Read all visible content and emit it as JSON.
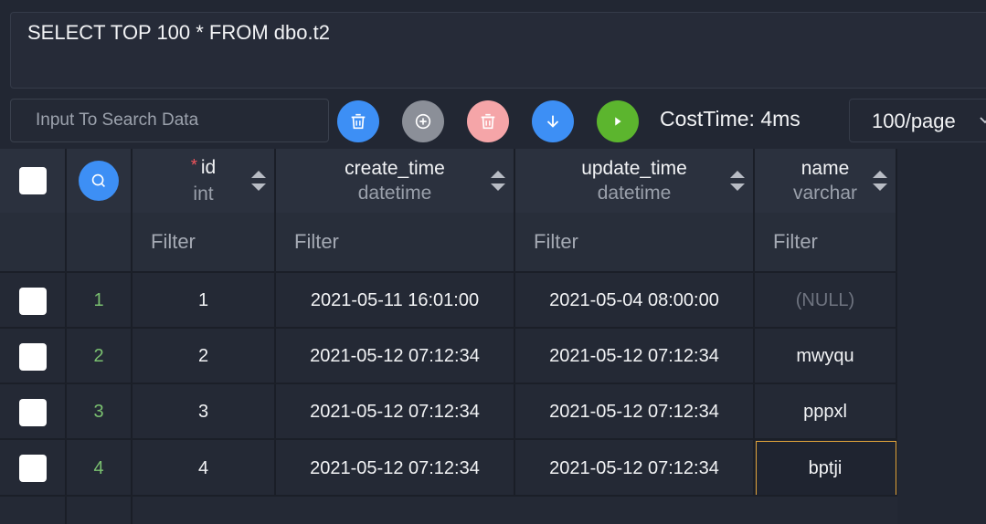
{
  "editor": {
    "sql": "SELECT TOP 100 * FROM dbo.t2"
  },
  "toolbar": {
    "search_placeholder": "Input To Search Data",
    "cost_label": "CostTime: 4ms",
    "page_size": "100/page",
    "colors": {
      "clear": "#3d8ff5",
      "add": "#8b8f98",
      "delete": "#f5a5a8",
      "export": "#3d8ff5",
      "run": "#5cb52e"
    }
  },
  "columns": [
    {
      "name": "id",
      "type": "int",
      "required": "*"
    },
    {
      "name": "create_time",
      "type": "datetime"
    },
    {
      "name": "update_time",
      "type": "datetime"
    },
    {
      "name": "name",
      "type": "varchar"
    }
  ],
  "filter_placeholder": "Filter",
  "rows": [
    {
      "num": "1",
      "id": "1",
      "create_time": "2021-05-11 16:01:00",
      "update_time": "2021-05-04 08:00:00",
      "name": "(NULL)"
    },
    {
      "num": "2",
      "id": "2",
      "create_time": "2021-05-12 07:12:34",
      "update_time": "2021-05-12 07:12:34",
      "name": "mwyqu"
    },
    {
      "num": "3",
      "id": "3",
      "create_time": "2021-05-12 07:12:34",
      "update_time": "2021-05-12 07:12:34",
      "name": "pppxl"
    },
    {
      "num": "4",
      "id": "4",
      "create_time": "2021-05-12 07:12:34",
      "update_time": "2021-05-12 07:12:34",
      "name": "bptji"
    }
  ]
}
